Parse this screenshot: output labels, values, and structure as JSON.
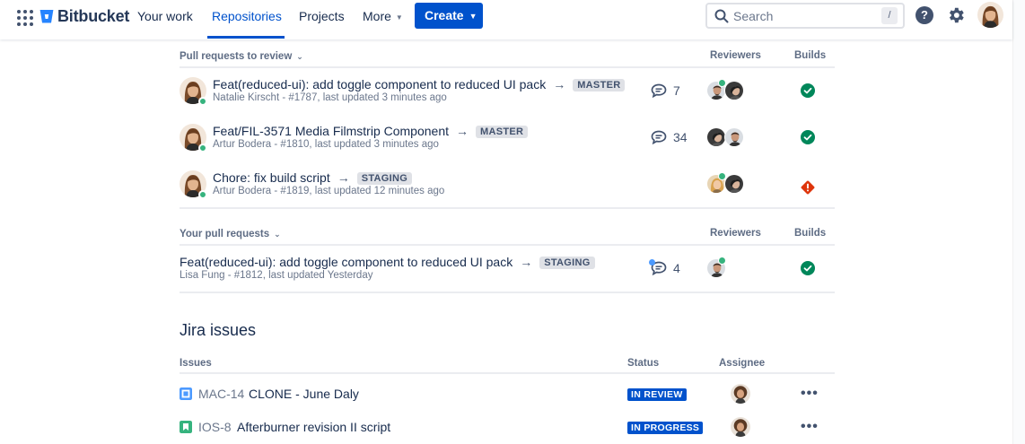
{
  "nav": {
    "brand": "Bitbucket",
    "items": [
      {
        "label": "Your work"
      },
      {
        "label": "Repositories"
      },
      {
        "label": "Projects"
      },
      {
        "label": "More"
      }
    ],
    "create_label": "Create",
    "search_placeholder": "Search",
    "search_shortcut": "/",
    "help_label": "?"
  },
  "pr_review": {
    "heading": "Pull requests to review",
    "col_reviewers": "Reviewers",
    "col_builds": "Builds",
    "rows": [
      {
        "title": "Feat(reduced-ui): add toggle component to reduced UI pack",
        "branch": "MASTER",
        "meta": "Natalie Kirscht - #1787, last updated  3 minutes ago",
        "comments": "7",
        "build": "success"
      },
      {
        "title": "Feat/FIL-3571 Media Filmstrip Component",
        "branch": "MASTER",
        "meta": "Artur Bodera - #1810, last updated 3 minutes ago",
        "comments": "34",
        "build": "success"
      },
      {
        "title": "Chore: fix build script",
        "branch": "STAGING",
        "meta": "Artur Bodera - #1819, last updated  12 minutes ago",
        "comments": "",
        "build": "failed"
      }
    ]
  },
  "your_prs": {
    "heading": "Your pull requests",
    "col_reviewers": "Reviewers",
    "col_builds": "Builds",
    "rows": [
      {
        "title": "Feat(reduced-ui): add toggle component to reduced UI pack",
        "branch": "STAGING",
        "meta": "Lisa Fung - #1812, last updated Yesterday",
        "comments": "4",
        "build": "success"
      }
    ]
  },
  "jira": {
    "title": "Jira issues",
    "col_issues": "Issues",
    "col_status": "Status",
    "col_assignee": "Assignee",
    "rows": [
      {
        "key": "MAC-14",
        "summary": "CLONE - June Daly",
        "status": "IN REVIEW",
        "type": "subtask"
      },
      {
        "key": "IOS-8",
        "summary": "Afterburner revision II script",
        "status": "IN PROGRESS",
        "type": "story"
      }
    ]
  },
  "colors": {
    "primary": "#0052CC",
    "success": "#36B37E",
    "danger": "#DE350B",
    "story": "#36B37E",
    "subtask": "#4C9AFF"
  }
}
